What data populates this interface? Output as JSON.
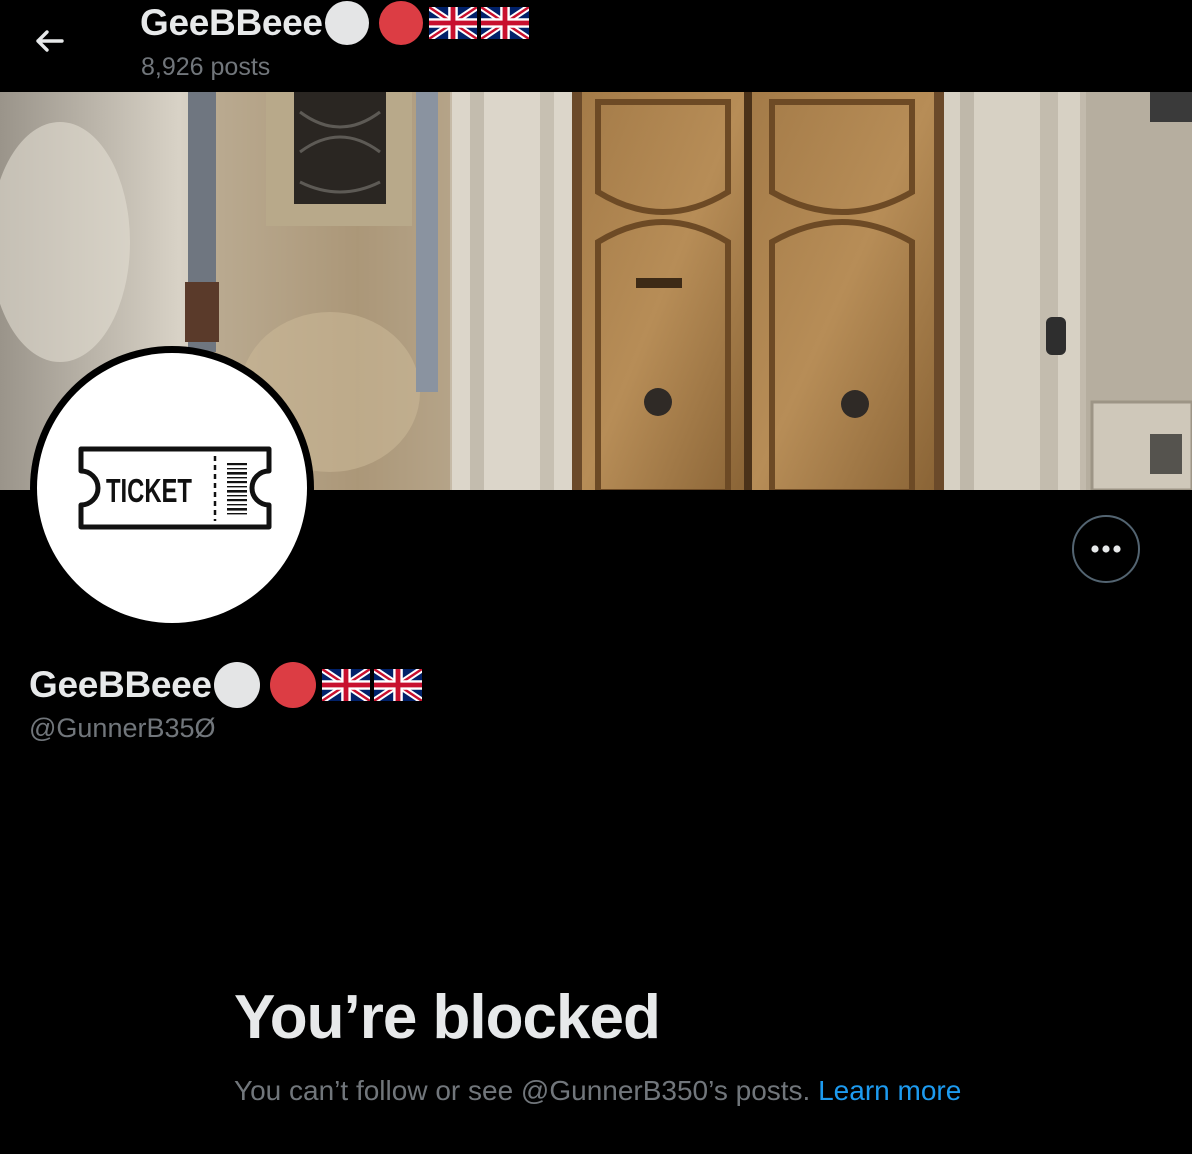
{
  "header": {
    "display_name": "GeeBBeee",
    "post_count": "8,926 posts"
  },
  "avatar": {
    "ticket_text": "TICKET"
  },
  "profile": {
    "display_name": "GeeBBeee",
    "handle": "@GunnerB35Ø"
  },
  "blocked": {
    "title": "You’re blocked",
    "message": "You can’t follow or see @GunnerB350’s posts.",
    "link_text": "Learn more"
  },
  "icons": [
    "back-arrow-icon",
    "more-options-icon",
    "white-circle-emoji",
    "red-circle-emoji",
    "uk-flag-emoji"
  ],
  "colors": {
    "background": "#000000",
    "text_primary": "#e7e9ea",
    "text_secondary": "#71767b",
    "link": "#1d9bf0",
    "emoji_red": "#dc3d44"
  }
}
